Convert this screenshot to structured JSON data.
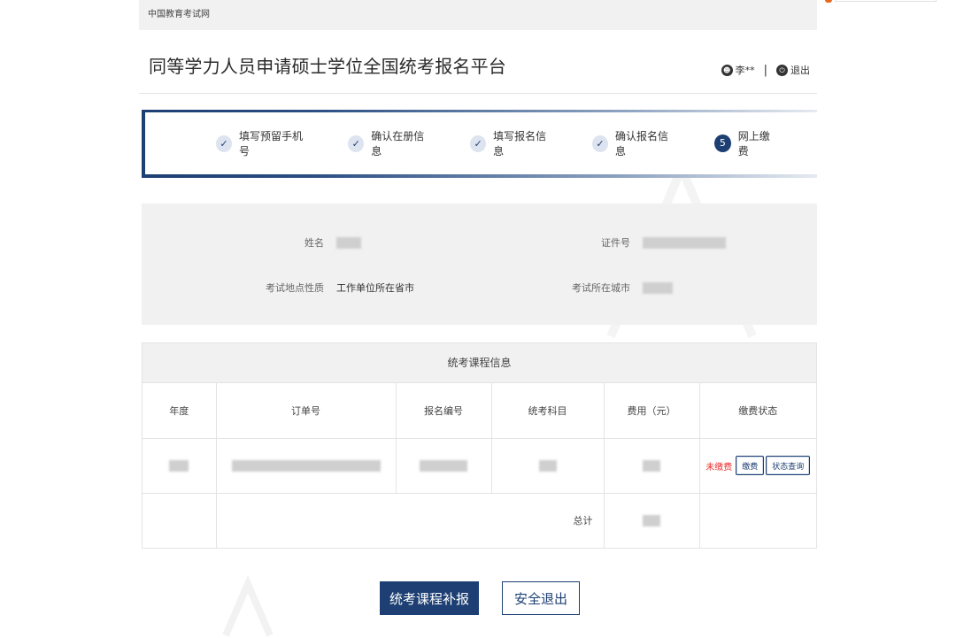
{
  "site": {
    "name": "中国教育考试网"
  },
  "header": {
    "title": "同等学力人员申请硕士学位全国统考报名平台",
    "user": "李**",
    "logout": "退出",
    "user_icon": "user-icon",
    "logout_icon": "power-icon"
  },
  "steps": [
    {
      "label": "填写预留手机号",
      "state": "done"
    },
    {
      "label": "确认在册信息",
      "state": "done"
    },
    {
      "label": "填写报名信息",
      "state": "done"
    },
    {
      "label": "确认报名信息",
      "state": "done"
    },
    {
      "label": "网上缴费",
      "state": "current",
      "number": "5"
    }
  ],
  "info": {
    "name_label": "姓名",
    "id_label": "证件号",
    "exam_location_type_label": "考试地点性质",
    "exam_location_type_value": "工作单位所在省市",
    "exam_city_label": "考试所在城市"
  },
  "course_table": {
    "title": "统考课程信息",
    "headers": [
      "年度",
      "订单号",
      "报名编号",
      "统考科目",
      "费用（元）",
      "缴费状态"
    ],
    "status": "未缴费",
    "pay_button": "缴费",
    "query_button": "状态查询",
    "total_label": "总计"
  },
  "actions": {
    "supplement": "统考课程补报",
    "exit": "安全退出"
  },
  "colors": {
    "primary": "#1d3f73",
    "unpaid": "#e8302e",
    "panel": "#f1f1f1"
  }
}
